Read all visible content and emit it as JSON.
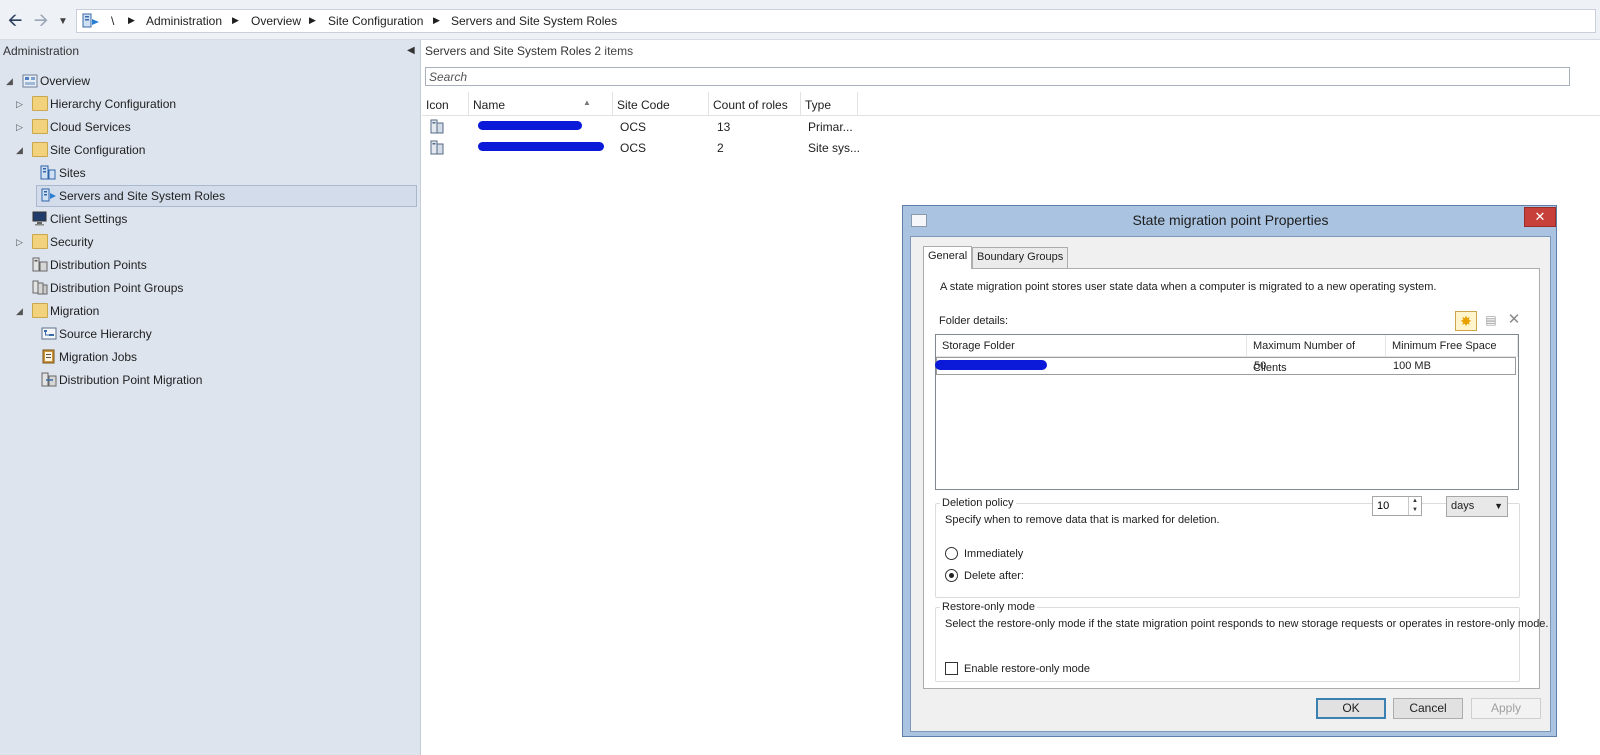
{
  "toolbar": {
    "back_icon": "back-arrow-icon",
    "forward_icon": "forward-arrow-icon",
    "history_icon": "dropdown-icon"
  },
  "breadcrumb": {
    "root": "\\",
    "items": [
      "Administration",
      "Overview",
      "Site Configuration",
      "Servers and Site System Roles"
    ]
  },
  "nav": {
    "header": "Administration",
    "tree": [
      {
        "label": "Overview"
      },
      {
        "label": "Hierarchy Configuration"
      },
      {
        "label": "Cloud Services"
      },
      {
        "label": "Site Configuration"
      },
      {
        "label": "Sites"
      },
      {
        "label": "Servers and Site System Roles"
      },
      {
        "label": "Client Settings"
      },
      {
        "label": "Security"
      },
      {
        "label": "Distribution Points"
      },
      {
        "label": "Distribution Point Groups"
      },
      {
        "label": "Migration"
      },
      {
        "label": "Source Hierarchy"
      },
      {
        "label": "Migration Jobs"
      },
      {
        "label": "Distribution Point Migration"
      }
    ]
  },
  "list": {
    "title": "Servers and Site System Roles",
    "count": "2 items",
    "search_placeholder": "Search",
    "columns": [
      "Icon",
      "Name",
      "Site Code",
      "Count of roles",
      "Type"
    ],
    "rows": [
      {
        "site_code": "OCS",
        "count": "13",
        "type": "Primar..."
      },
      {
        "site_code": "OCS",
        "count": "2",
        "type": "Site sys..."
      }
    ]
  },
  "dialog": {
    "title": "State migration point Properties",
    "close_label": "✕",
    "tabs": [
      "General",
      "Boundary Groups"
    ],
    "description": "A state migration point stores user state data when a computer is migrated to a new operating system.",
    "folder_details_label": "Folder details:",
    "folder_columns": [
      "Storage Folder",
      "Maximum Number of Clients",
      "Minimum Free Space"
    ],
    "folder_row": {
      "max_clients": "50",
      "min_free": "100 MB"
    },
    "deletion_policy": {
      "title": "Deletion policy",
      "hint": "Specify when to remove data that is marked for deletion.",
      "immediately": "Immediately",
      "delete_after": "Delete after:",
      "value": "10",
      "unit": "days"
    },
    "restore_only": {
      "title": "Restore-only mode",
      "hint": "Select the restore-only mode if the state migration point responds to new storage requests or operates in restore-only mode.",
      "checkbox_label": "Enable restore-only mode"
    },
    "buttons": {
      "ok": "OK",
      "cancel": "Cancel",
      "apply": "Apply"
    }
  }
}
